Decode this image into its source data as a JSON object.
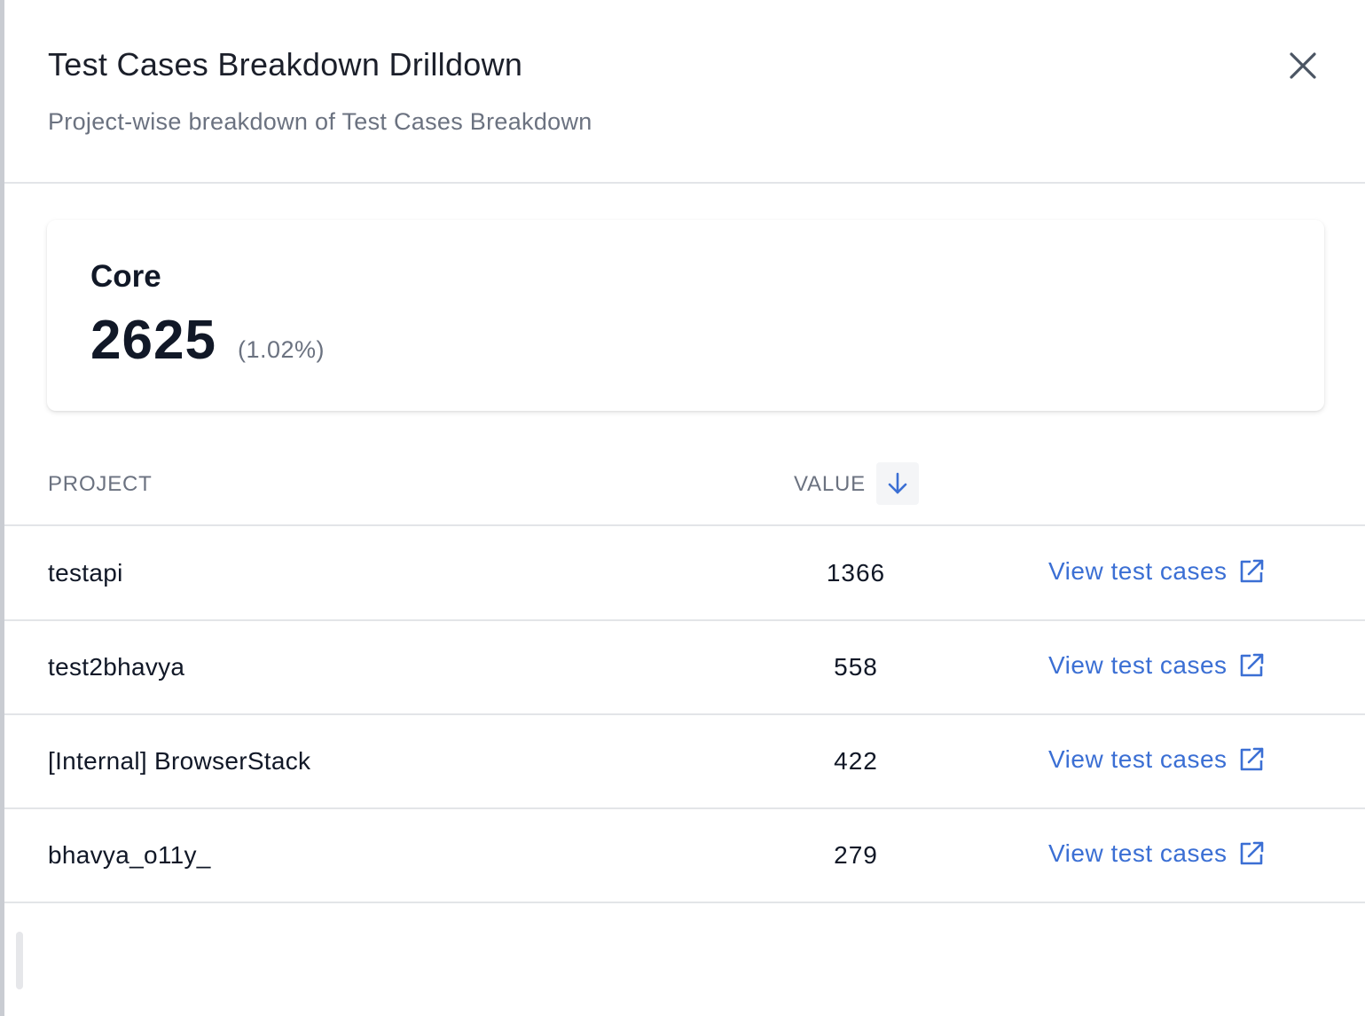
{
  "header": {
    "title": "Test Cases Breakdown Drilldown",
    "subtitle": "Project-wise breakdown of Test Cases Breakdown",
    "close_icon": "close-icon"
  },
  "summary": {
    "label": "Core",
    "value": "2625",
    "percent": "(1.02%)"
  },
  "table": {
    "columns": {
      "project": "PROJECT",
      "value": "VALUE",
      "sort_icon": "arrow-down-icon"
    },
    "rows": [
      {
        "project": "testapi",
        "value": "1366",
        "link": "View test cases"
      },
      {
        "project": "test2bhavya",
        "value": "558",
        "link": "View test cases"
      },
      {
        "project": "[Internal] BrowserStack",
        "value": "422",
        "link": "View test cases"
      },
      {
        "project": "bhavya_o11y_",
        "value": "279",
        "link": "View test cases"
      }
    ],
    "link_icon": "external-link-icon"
  },
  "colors": {
    "link": "#3b6fd4",
    "text": "#111827",
    "muted": "#6b7280",
    "divider": "#e3e5e8"
  }
}
